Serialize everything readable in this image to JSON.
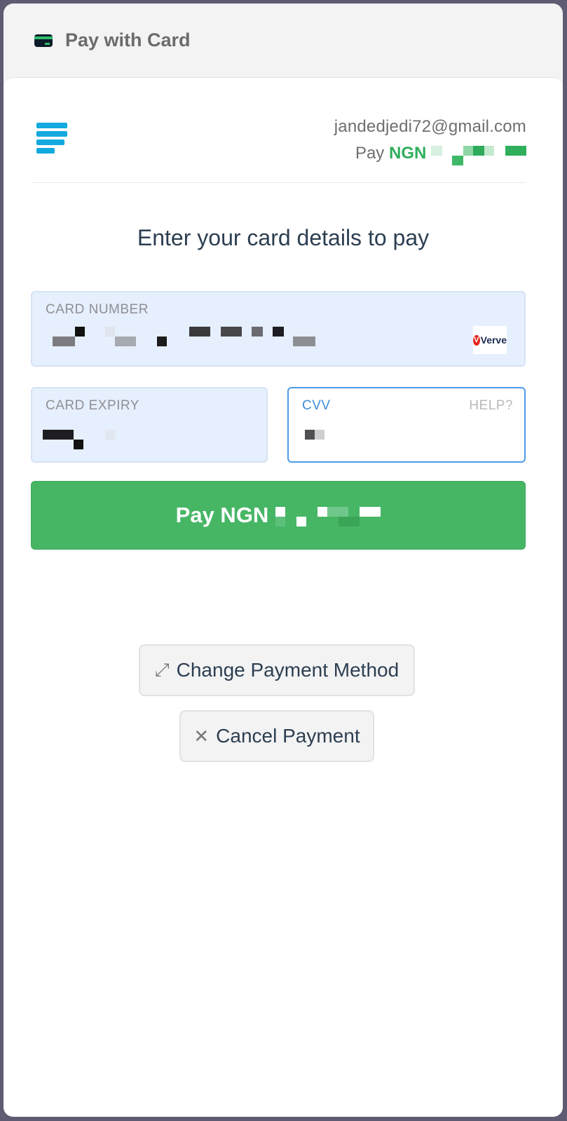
{
  "topbar": {
    "icon": "credit-card-icon",
    "title": "Pay with Card"
  },
  "header": {
    "logo": "paystack-logo",
    "email": "jandedjedi72@gmail.com",
    "pay_prefix": "Pay",
    "currency": "NGN"
  },
  "main": {
    "heading": "Enter your card details to pay",
    "card_number": {
      "label": "CARD NUMBER",
      "brand": "Verve"
    },
    "card_expiry": {
      "label": "CARD EXPIRY"
    },
    "cvv": {
      "label": "CVV",
      "help": "HELP?"
    },
    "pay_button": {
      "label": "Pay NGN"
    }
  },
  "actions": {
    "change_method": {
      "icon": "swap-arrows-icon",
      "label": "Change Payment Method"
    },
    "cancel": {
      "icon": "close-icon",
      "label": "Cancel Payment"
    }
  },
  "colors": {
    "accent_green": "#46b665",
    "brand_blue": "#12a9df",
    "focus_blue": "#4b9be6"
  }
}
